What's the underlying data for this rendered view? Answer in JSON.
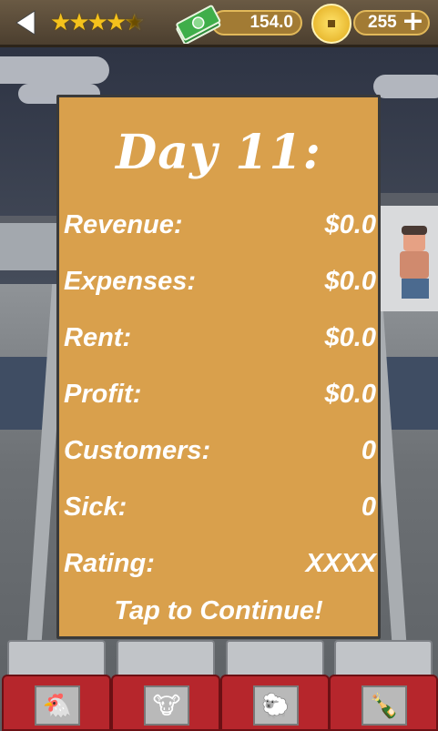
{
  "topbar": {
    "back_icon": "back-arrow-icon",
    "rating_stars": 4.5,
    "rating_max": 5,
    "money_icon": "cash-stack-icon",
    "money_value": "154.0",
    "coin_icon": "gold-coin-icon",
    "coin_value": "255",
    "plus_label": "+"
  },
  "panel": {
    "title": "Day 11:",
    "rows": [
      {
        "label": "Revenue:",
        "value": "$0.0"
      },
      {
        "label": "Expenses:",
        "value": "$0.0"
      },
      {
        "label": "Rent:",
        "value": "$0.0"
      },
      {
        "label": "Profit:",
        "value": "$0.0"
      },
      {
        "label": "Customers:",
        "value": "0"
      },
      {
        "label": "Sick:",
        "value": "0"
      },
      {
        "label": "Rating:",
        "value": "XXXX"
      }
    ],
    "continue_label": "Tap to Continue!"
  },
  "trays": [
    {
      "icon": "chicken-icon"
    },
    {
      "icon": "cow-icon"
    },
    {
      "icon": "sheep-icon"
    },
    {
      "icon": "bottle-icon"
    }
  ],
  "colors": {
    "panel": "#d9a04c",
    "star": "#f5c21c",
    "tray": "#b6262c"
  }
}
